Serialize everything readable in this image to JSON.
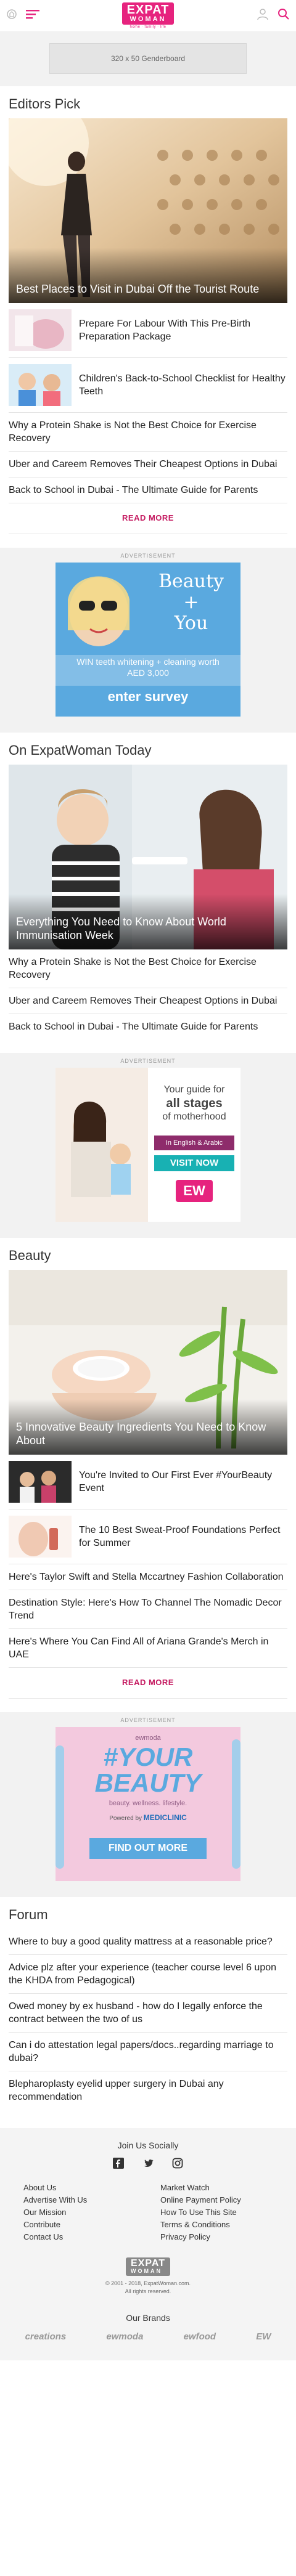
{
  "header": {
    "logo_top": "EXPAT",
    "logo_bottom": "WOMAN",
    "logo_tag": "home · family · life"
  },
  "leaderboard": {
    "label": "320 x 50 Genderboard"
  },
  "editors_pick": {
    "title": "Editors Pick",
    "hero_title": "Best Places to Visit in Dubai Off the Tourist Route",
    "thumb_items": [
      "Prepare For Labour With This Pre-Birth Preparation Package",
      "Children's Back-to-School Checklist for Healthy Teeth"
    ],
    "text_items": [
      "Why a Protein Shake is Not the Best Choice for Exercise Recovery",
      "Uber and Careem Removes Their Cheapest Options in Dubai",
      "Back to School in Dubai - The Ultimate Guide for Parents"
    ],
    "read_more": "READ MORE"
  },
  "ad1": {
    "label": "ADVERTISEMENT",
    "headline_1": "Beauty +",
    "headline_2": "You",
    "offer": "WIN teeth whitening + cleaning worth AED 3,000",
    "cta": "enter survey"
  },
  "today": {
    "title": "On ExpatWoman Today",
    "hero_title": "Everything You Need to Know About World Immunisation Week",
    "text_items": [
      "Why a Protein Shake is Not the Best Choice for Exercise Recovery",
      "Uber and Careem Removes Their Cheapest Options in Dubai",
      "Back to School in Dubai - The Ultimate Guide for Parents"
    ]
  },
  "ad2": {
    "label": "ADVERTISEMENT",
    "line1": "Your guide for",
    "line2": "all stages",
    "line3": "of motherhood",
    "lang": "In English & Arabic",
    "cta": "VISIT NOW",
    "brand": "EW"
  },
  "beauty": {
    "title": "Beauty",
    "hero_title": "5 Innovative Beauty Ingredients You Need to Know About",
    "thumb_items": [
      "You're Invited to Our First Ever #YourBeauty Event",
      "The 10 Best Sweat-Proof Foundations Perfect for Summer"
    ],
    "text_items": [
      "Here's Taylor Swift and Stella Mccartney Fashion Collaboration",
      "Destination Style: Here's How To Channel The Nomadic Decor Trend",
      "Here's Where You Can Find All of Ariana Grande's Merch in UAE"
    ],
    "read_more": "READ MORE"
  },
  "ad3": {
    "label": "ADVERTISEMENT",
    "top": "ewmoda",
    "headline_1": "#YOUR",
    "headline_2": "BEAUTY",
    "sub": "beauty. wellness. lifestyle.",
    "powered": "Powered by",
    "sponsor": "MEDICLINIC",
    "cta": "FIND OUT MORE"
  },
  "forum": {
    "title": "Forum",
    "items": [
      "Where to buy a good quality mattress at a reasonable price?",
      "Advice plz after your experience (teacher course level 6 upon the KHDA from Pedagogical)",
      "Owed money by ex husband - how do I legally enforce the contract between the two of us",
      "Can i do attestation legal papers/docs..regarding marriage to dubai?",
      "Blepharoplasty eyelid upper surgery in Dubai any recommendation"
    ]
  },
  "footer": {
    "social_title": "Join Us Socially",
    "links": [
      "About Us",
      "Market Watch",
      "Advertise With Us",
      "Online Payment Policy",
      "Our Mission",
      "How To Use This Site",
      "Contribute",
      "Terms & Conditions",
      "Contact Us",
      "Privacy Policy"
    ],
    "copyright": "© 2001 - 2018, ExpatWoman.com.",
    "rights": "All rights reserved.",
    "brands_title": "Our Brands",
    "brands": [
      "creations",
      "ewmoda",
      "ewfood",
      "EW"
    ]
  },
  "colors": {
    "brand": "#e6237e",
    "read_more": "#c4185f",
    "ad_blue": "#5aa9df",
    "ad_pink": "#f2c4dc"
  }
}
